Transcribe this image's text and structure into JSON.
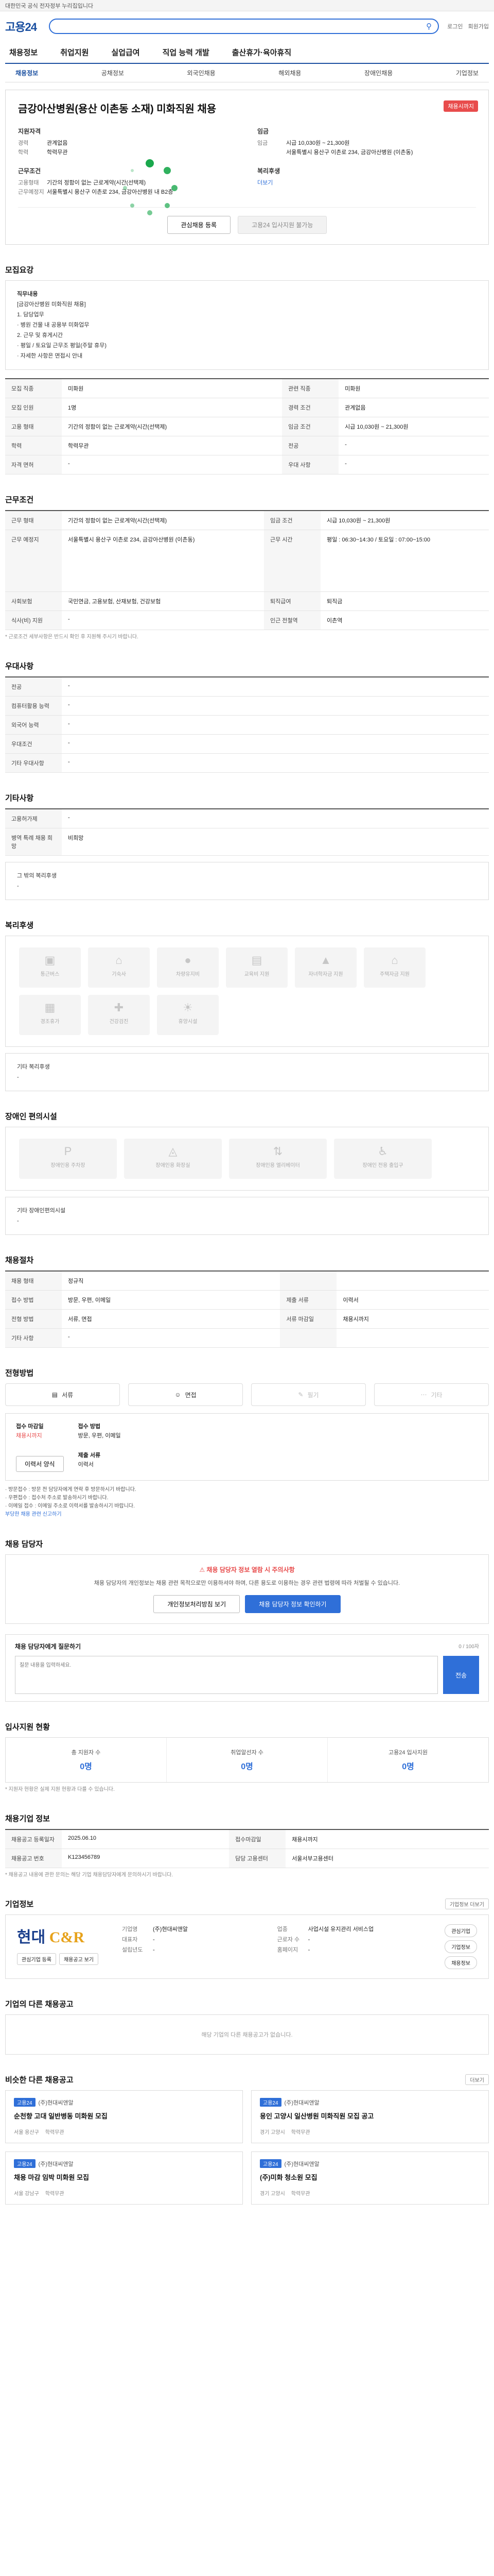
{
  "topbar": {
    "text": "대한민국 공식 전자정부 누리집입니다"
  },
  "header": {
    "logo": "고용24",
    "search_placeholder": "",
    "util": [
      "로그인",
      "회원가입"
    ]
  },
  "gnb": [
    "채용정보",
    "취업지원",
    "실업급여",
    "직업 능력 개발",
    "출산휴가·육아휴직"
  ],
  "snb": {
    "items": [
      "채용정보",
      "공채정보",
      "외국인채용",
      "해외채용",
      "장애인채용",
      "기업정보"
    ],
    "active_index": 0
  },
  "hero": {
    "title": "금강아산병원(용산 이촌동 소재) 미화직원 채용",
    "badge": "채용시까지",
    "left_title": "지원자격",
    "left": [
      [
        "경력",
        "관계없음"
      ],
      [
        "학력",
        "학력무관"
      ]
    ],
    "work_title": "근무조건",
    "work": [
      [
        "고용형태",
        "기간의 정함이 없는 근로계약(시간(선택제)"
      ],
      [
        "근무예정지",
        "서울특별시 용산구 이촌로 234, 금강아산병원 내 B2층"
      ]
    ],
    "right_title": "임금",
    "right": [
      [
        "임금",
        "시급 10,030원 ~ 21,300원"
      ]
    ],
    "right_extra": "서울특별시 용산구 이촌로 234, 금강아산병원 (이촌동)",
    "welfare_title": "복리후생",
    "welfare_link": "더보기",
    "btn_save": "관심채용 등록",
    "btn_apply": "고용24 입사지원 불가능"
  },
  "job_desc": {
    "title": "모집요강",
    "lines": [
      "직무내용",
      "[금강아산병원 미화직원 채용]",
      "1. 담당업무",
      "· 병원 건물 내 공용부 미화업무",
      "2. 근무 및 휴게시간",
      "· 평일 / 토요일 근무조 평일(주말 휴무)",
      "· 자세한 사항은 면접시 안내"
    ]
  },
  "recruit_table": {
    "rows": [
      [
        "모집 직종",
        "미화원",
        "관련 직종",
        "미화원"
      ],
      [
        "모집 인원",
        "1명",
        "경력 조건",
        "관계없음"
      ],
      [
        "고용 형태",
        "기간의 정함이 없는 근로계약(시간(선택제)",
        "임금 조건",
        "시급 10,030원 ~ 21,300원"
      ],
      [
        "학력",
        "학력무관",
        "전공",
        "-"
      ],
      [
        "자격 면허",
        "-",
        "우대 사항",
        "-"
      ]
    ]
  },
  "work_cond": {
    "title": "근무조건",
    "rows": [
      [
        "근무 형태",
        "기간의 정함이 없는 근로계약(시간(선택제)",
        "임금 조건",
        "시급 10,030원 ~ 21,300원"
      ],
      [
        "근무 예정지",
        "서울특별시 용산구 이촌로 234, 금강아산병원 (이촌동)",
        "근무 시간",
        "평일 : 06:30~14:30 / 토요일 : 07:00~15:00"
      ],
      [
        "사회보험",
        "국민연금, 고용보험, 산재보험, 건강보험",
        "퇴직급여",
        "퇴직금"
      ],
      [
        "식사(비) 지원",
        "-",
        "인근 전철역",
        "이촌역"
      ]
    ],
    "note": "* 근로조건 세부사항은 반드시 확인 후 지원해 주시기 바랍니다."
  },
  "preference": {
    "title": "우대사항",
    "rows": [
      [
        "전공",
        "-"
      ],
      [
        "컴퓨터활용 능력",
        "-"
      ],
      [
        "외국어 능력",
        "-"
      ],
      [
        "우대조건",
        "-"
      ],
      [
        "기타 우대사항",
        "-"
      ]
    ]
  },
  "etc": {
    "title": "기타사항",
    "rows": [
      [
        "고용허가제",
        "-"
      ],
      [
        "병역 특례 채용 희망",
        "비희망"
      ]
    ],
    "extra_label": "그 밖의 복리후생",
    "extra_value": "-"
  },
  "welfare": {
    "title": "복리후생",
    "items": [
      "통근버스",
      "기숙사",
      "차량유지비",
      "교육비 지원",
      "자녀학자금 지원",
      "주택자금 지원",
      "경조휴가",
      "건강검진",
      "휴양시설"
    ],
    "other_label": "기타 복리후생",
    "other_value": "-"
  },
  "disability": {
    "title": "장애인 편의시설",
    "items": [
      "장애인용 주차장",
      "장애인용 화장실",
      "장애인용 엘리베이터",
      "장애인 전용 출입구"
    ],
    "other_label": "기타 장애인편의시설",
    "other_value": "-"
  },
  "selection": {
    "title": "채용절차",
    "rows": [
      [
        "채용 형태",
        "정규직",
        "",
        ""
      ],
      [
        "접수 방법",
        "방문, 우편, 이메일",
        "제출 서류",
        "이력서"
      ],
      [
        "전형 방법",
        "서류, 면접",
        "서류 마감일",
        "채용시까지"
      ],
      [
        "기타 사항",
        "-",
        "",
        ""
      ]
    ]
  },
  "methods": {
    "title": "전형방법",
    "items": [
      "서류",
      "면접",
      "필기",
      "기타"
    ],
    "disabled": [
      false,
      false,
      true,
      true
    ]
  },
  "apply": {
    "deadline_label": "접수 마감일",
    "deadline_value": "채용시까지",
    "method_label": "접수 방법",
    "method_value": "방문, 우편, 이메일",
    "doc_label": "제출 서류",
    "doc_value": "이력서",
    "btn_print": "이력서 양식",
    "notices": [
      "· 방문접수 : 방문 전 담당자에게 연락 후 방문하시기 바랍니다.",
      "· 우편접수 : 접수처 주소로 발송하시기 바랍니다.",
      "· 이메일 접수 : 이메일 주소로 이력서를 발송하시기 바랍니다."
    ],
    "notice_link": "부당한 채용 관련 신고하기"
  },
  "manager": {
    "title": "채용 담당자",
    "alert": "채용 담당자 정보 열람 시 주의사항",
    "desc": "채용 담당자의 개인정보는 채용 관련 목적으로만 이용하셔야 하며, 다른 용도로 이용하는 경우 관련 법령에 따라 처벌될 수 있습니다.",
    "btn_view": "개인정보처리방침 보기",
    "btn_contact": "채용 담당자 정보 확인하기"
  },
  "inquiry": {
    "title": "채용 담당자에게 질문하기",
    "count": "0 / 100자",
    "placeholder": "질문 내용을 입력하세요.",
    "btn": "전송"
  },
  "status": {
    "title": "입사지원 현황",
    "items": [
      [
        "총 지원자 수",
        "0명"
      ],
      [
        "취업알선자 수",
        "0명"
      ],
      [
        "고용24 입사지원",
        "0명"
      ]
    ],
    "note": "* 지원자 현황은 실제 지원 현황과 다를 수 있습니다."
  },
  "info_table": {
    "title": "채용기업 정보",
    "rows": [
      [
        "채용공고 등록일자",
        "2025.06.10",
        "접수마감일",
        "채용시까지"
      ],
      [
        "채용공고 번호",
        "K123456789",
        "담당 고용센터",
        "서울서부고용센터"
      ]
    ],
    "note": "* 채용공고 내용에 관한 문의는 해당 기업 채용담당자에게 문의하시기 바랍니다."
  },
  "company": {
    "title": "기업정보",
    "more": "기업정보 더보기",
    "logo_main": "현대",
    "logo_sub": "C&R",
    "btn_a": "관심기업 등록",
    "btn_b": "채용공고 보기",
    "info": [
      [
        "기업명",
        "(주)현대씨앤알",
        "업종",
        "사업시설 유지관리 서비스업"
      ],
      [
        "대표자",
        "-",
        "근로자 수",
        "-"
      ],
      [
        "설립년도",
        "-",
        "홈페이지",
        "-"
      ]
    ],
    "side": [
      "관심기업",
      "기업정보",
      "채용정보"
    ]
  },
  "other_jobs": {
    "title": "기업의 다른 채용공고",
    "empty": "해당 기업의 다른 채용공고가 없습니다."
  },
  "similar_jobs": {
    "title": "비슷한 다른 채용공고",
    "more": "더보기",
    "cards": [
      {
        "tag": "고용24",
        "company": "(주)현대씨앤알",
        "title": "순천향 고대 일반병동 미화원 모집",
        "meta": [
          "서울 용산구",
          "학력무관"
        ]
      },
      {
        "tag": "고용24",
        "company": "(주)현대씨앤알",
        "title": "용인 고양시 일산병원 미화직원 모집 공고",
        "meta": [
          "경기 고양시",
          "학력무관"
        ]
      },
      {
        "tag": "고용24",
        "company": "(주)현대씨앤알",
        "title": "채용 마감 임박 미화원 모집",
        "meta": [
          "서울 강남구",
          "학력무관"
        ]
      },
      {
        "tag": "고용24",
        "company": "(주)현대씨앤알",
        "title": "(주)미화 청소원 모집",
        "meta": [
          "경기 고양시",
          "학력무관"
        ]
      }
    ]
  }
}
